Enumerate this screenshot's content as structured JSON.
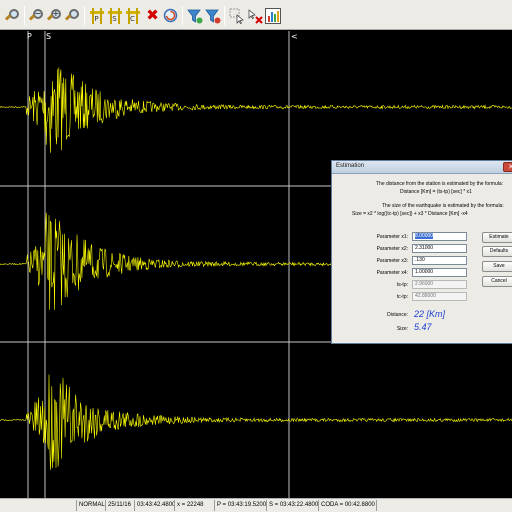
{
  "toolbar": {
    "icons": [
      "pan-icon",
      "zoom-out-icon",
      "zoom-in-icon",
      "zoom-fit-icon",
      "pick-p-icon",
      "pick-s-icon",
      "pick-coda-icon",
      "delete-icon",
      "reset-icon",
      "filter-add-icon",
      "filter-remove-icon",
      "pointer-icon",
      "clear-pointer-icon",
      "chart-icon"
    ],
    "pick_labels": {
      "p": "P",
      "s": "S",
      "coda": "C"
    }
  },
  "plot": {
    "markers": {
      "p": "P",
      "s": "S",
      "coda": "<"
    },
    "trace_color": "#ffff00",
    "divider_color": "#c8c8c8"
  },
  "statusbar": {
    "mode": "NORMAL",
    "date": "25/11/16",
    "time": "03:43:42.4800",
    "x": "x = 22248",
    "p": "P = 03:43:19.5200",
    "s": "S = 03:43:22.4800",
    "coda": "CODA = 00:42.8800"
  },
  "dialog": {
    "title": "Estimation",
    "close_label": "✕",
    "distance_text_1": "The distance from the station is estimated by the formula:",
    "distance_formula": "Distance [Km] = (ts-tp) [sec] * x1",
    "size_text_1": "The size of the earthquake is estimated by the formula:",
    "size_formula": "Size = x2 * log((tc-tp) [sec]) + x3 * Distance [Km] -x4",
    "params": [
      {
        "label": "Parameter x1:",
        "value": "8.00000"
      },
      {
        "label": "Parameter x2:",
        "value": "2.31000"
      },
      {
        "label": "Parameter x3:",
        "value": ".130"
      },
      {
        "label": "Parameter x4:",
        "value": "1.00000"
      },
      {
        "label": "ts-tp:",
        "value": "2.96000"
      },
      {
        "label": "tc-tp:",
        "value": "42.88000"
      }
    ],
    "buttons": {
      "estimate": "Estimate",
      "defaults": "Defaults",
      "save": "Save",
      "cancel": "Cancel"
    },
    "distance_label": "Distance:",
    "distance_value": "22 [Km]",
    "size_label": "Size:",
    "size_value": "5.47"
  }
}
